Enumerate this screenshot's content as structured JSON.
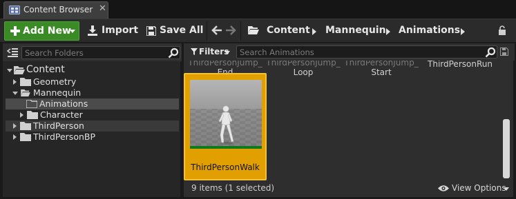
{
  "tab": {
    "title": "Content Browser",
    "close_glyph": "✕",
    "icon": "content-browser-icon"
  },
  "toolbar": {
    "add_new_label": "Add New",
    "import_label": "Import",
    "save_all_label": "Save All"
  },
  "breadcrumbs": [
    "Content",
    "Mannequin",
    "Animations"
  ],
  "folder_search": {
    "placeholder": "Search Folders"
  },
  "folder_tree": [
    {
      "label": "Content",
      "expanded": true,
      "selected": false
    },
    {
      "label": "Geometry",
      "expanded": false,
      "selected": false
    },
    {
      "label": "Mannequin",
      "expanded": true,
      "selected": false
    },
    {
      "label": "Animations",
      "expanded": false,
      "selected": true
    },
    {
      "label": "Character",
      "expanded": false,
      "selected": false
    },
    {
      "label": "ThirdPerson",
      "expanded": false,
      "selected": false
    },
    {
      "label": "ThirdPersonBP",
      "expanded": false,
      "selected": false
    }
  ],
  "filters": {
    "label": "Filters"
  },
  "asset_search": {
    "placeholder": "Search Animations"
  },
  "assets_partial": [
    {
      "cut_text": "ThirdPersonJump_",
      "label": "End"
    },
    {
      "cut_text": "ThirdPersonJump_",
      "label": "Loop"
    },
    {
      "cut_text": "ThirdPersonJump_",
      "label": "Start"
    },
    {
      "cut_text": "",
      "label": "ThirdPersonRun"
    }
  ],
  "selected_asset": {
    "name": "ThirdPersonWalk"
  },
  "footer": {
    "items_count": "9 items (1 selected)",
    "view_options_label": "View Options"
  },
  "colors": {
    "add_new": "#3a8a25",
    "selection": "#e1a000",
    "tree_selected": "#4b4b4b",
    "tree_hover": "#3a3a3a"
  }
}
